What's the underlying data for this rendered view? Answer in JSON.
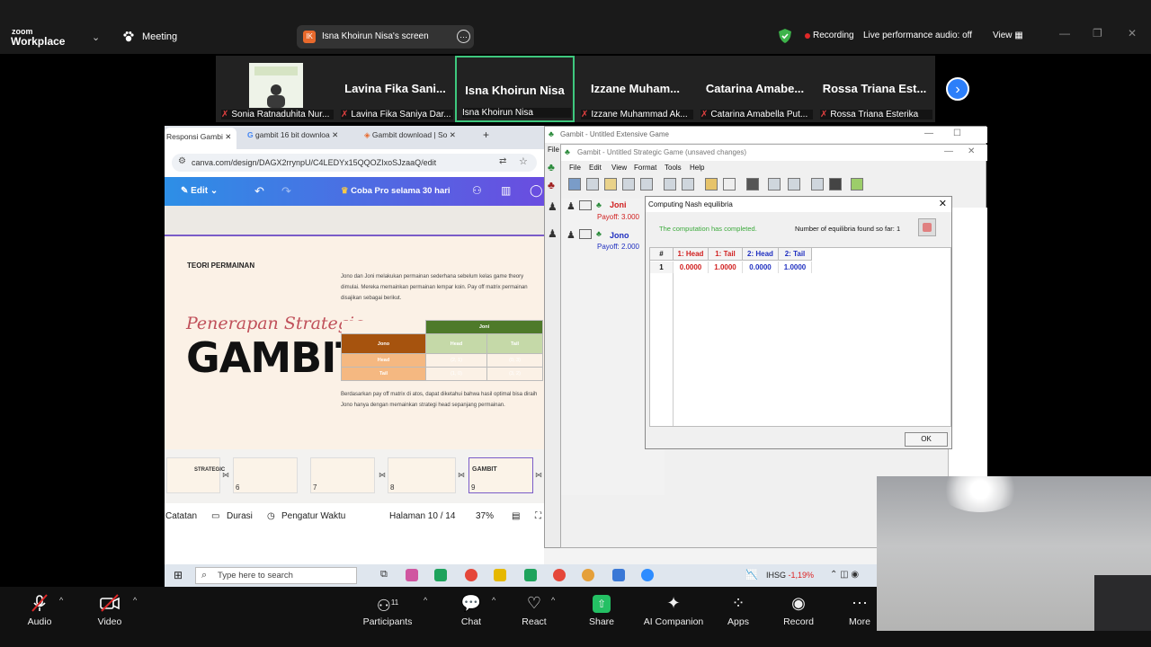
{
  "zoom": {
    "logo_top": "zoom",
    "logo_bottom": "Workplace",
    "meeting_label": "Meeting",
    "share_initials": "IK",
    "share_label": "Isna Khoirun Nisa's screen",
    "recording": "Recording",
    "live_audio": "Live performance audio: off",
    "view": "View"
  },
  "gallery": [
    {
      "name": "",
      "sub": "Sonia Ratnaduhita Nur...",
      "muted": true
    },
    {
      "name": "Lavina Fika Sani...",
      "sub": "Lavina Fika Saniya Dar...",
      "muted": true
    },
    {
      "name": "Isna Khoirun Nisa",
      "sub": "Isna Khoirun Nisa",
      "muted": false
    },
    {
      "name": "Izzane Muham...",
      "sub": "Izzane Muhammad Ak...",
      "muted": true
    },
    {
      "name": "Catarina Amabe...",
      "sub": "Catarina Amabella Put...",
      "muted": true
    },
    {
      "name": "Rossa Triana Est...",
      "sub": "Rossa Triana Esterika",
      "muted": true
    }
  ],
  "browser": {
    "tabs": [
      "Responsi Gambi",
      "gambit 16 bit downloa",
      "Gambit download | So"
    ],
    "url": "canva.com/design/DAGX2rrynpU/C4LEDYx15QQOZIxoSJzaaQ/edit",
    "edit": "Edit",
    "pro": "Coba Pro selama 30 hari"
  },
  "slide": {
    "heading": "TEORI PERMAINAN",
    "script_title": "Penerapan Strategic",
    "big_title": "GAMBIT",
    "para1": "Jono dan Joni melakukan permainan sederhana sebelum kelas game theory dimulai. Mereka memainkan permainan lempar koin. Pay off matrix permainan disajikan sebagai berikut.",
    "para2": "Berdasarkan pay off matrix di atos, dapat diketahui bahwa hasil optimal bisa diraih Jono hanya dengan memainkan strategi head sepanjang permainan.",
    "matrix": {
      "col_player": "Joni",
      "row_player": "Jono",
      "cols": [
        "Head",
        "Tail"
      ],
      "rows": [
        {
          "label": "Head",
          "cells": [
            "(2, 1)",
            "(0, 3)"
          ]
        },
        {
          "label": "Tail",
          "cells": [
            "(1, 0)",
            "(3, 2)"
          ]
        }
      ]
    }
  },
  "thumbs": [
    {
      "num": "6",
      "text": "STRATEGIC"
    },
    {
      "num": "7",
      "text": ""
    },
    {
      "num": "8",
      "text": ""
    },
    {
      "num": "9",
      "text": "GAMBIT"
    }
  ],
  "canva_footer": {
    "notes": "Catatan",
    "duration": "Durasi",
    "timer": "Pengatur Waktu",
    "page": "Halaman 10 / 14",
    "zoom": "37%"
  },
  "gambit": {
    "ext_title": "Gambit - Untitled Extensive Game",
    "file": "File",
    "strat_title": "Gambit - Untitled Strategic Game (unsaved changes)",
    "menu": [
      "File",
      "Edit",
      "View",
      "Format",
      "Tools",
      "Help"
    ],
    "players": [
      {
        "name": "Joni",
        "payoff": "Payoff: 3.000",
        "color": "#d02020"
      },
      {
        "name": "Jono",
        "payoff": "Payoff: 2.000",
        "color": "#2030c0"
      }
    ]
  },
  "nash": {
    "title": "Computing Nash equilibria",
    "status": "The computation has completed.",
    "found": "Number of equilibria found so far: 1",
    "headers": [
      "#",
      "1: Head",
      "1: Tail",
      "2: Head",
      "2: Tail"
    ],
    "row": [
      "1",
      "0.0000",
      "1.0000",
      "0.0000",
      "1.0000"
    ],
    "ok": "OK"
  },
  "taskbar": {
    "search": "Type here to search",
    "ihsg": "IHSG",
    "ihsg_pct": "-1,19%"
  },
  "bottom": [
    {
      "label": "Audio",
      "icon": "mic-off-icon"
    },
    {
      "label": "Video",
      "icon": "video-off-icon"
    },
    {
      "label": "Participants",
      "icon": "participants-icon",
      "count": "11"
    },
    {
      "label": "Chat",
      "icon": "chat-icon"
    },
    {
      "label": "React",
      "icon": "heart-icon"
    },
    {
      "label": "Share",
      "icon": "share-icon"
    },
    {
      "label": "AI Companion",
      "icon": "sparkle-icon"
    },
    {
      "label": "Apps",
      "icon": "apps-icon"
    },
    {
      "label": "Record",
      "icon": "record-icon"
    },
    {
      "label": "More",
      "icon": "more-icon"
    }
  ]
}
